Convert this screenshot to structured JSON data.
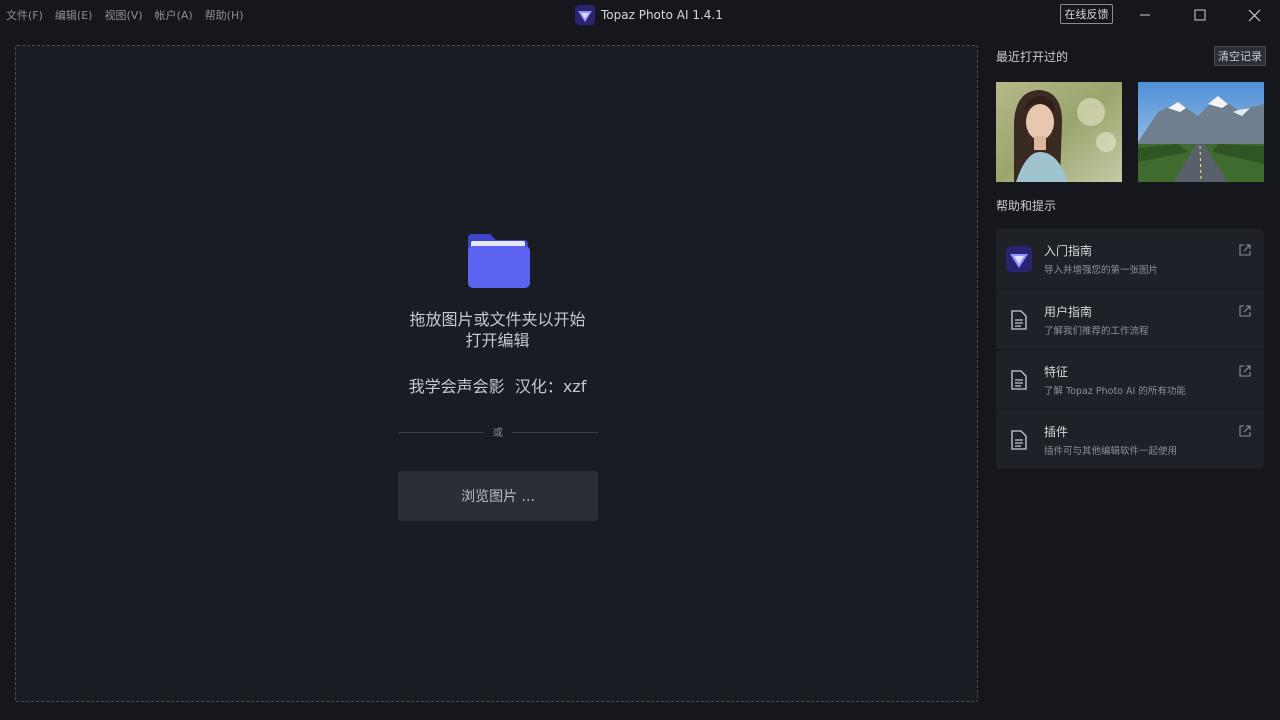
{
  "menu": [
    "文件(F)",
    "编辑(E)",
    "视图(V)",
    "帐户(A)",
    "帮助(H)"
  ],
  "app": {
    "title": "Topaz Photo AI 1.4.1",
    "logo_icon": "topaz-diamond-icon"
  },
  "feedback_label": "在线反馈",
  "window_controls": [
    "minimize-icon",
    "maximize-icon",
    "close-icon"
  ],
  "dropzone": {
    "folder_icon": "folder-icon",
    "line1": "拖放图片或文件夹以开始",
    "line2": "打开编辑",
    "credit": "我学会声会影  汉化：xzf",
    "or": "或",
    "browse": "浏览图片 ..."
  },
  "recent": {
    "title": "最近打开过的",
    "clear": "清空记录",
    "thumbs": [
      "portrait-photo",
      "mountain-road-photo"
    ]
  },
  "help": {
    "title": "帮助和提示",
    "items": [
      {
        "title": "入门指南",
        "desc": "导入并增强您的第一张图片",
        "icon": "topaz-diamond-icon"
      },
      {
        "title": "用户指南",
        "desc": "了解我们推荐的工作流程",
        "icon": "document-icon"
      },
      {
        "title": "特征",
        "desc": "了解 Topaz Photo AI 的所有功能",
        "icon": "document-icon"
      },
      {
        "title": "插件",
        "desc": "插件可与其他编辑软件一起使用",
        "icon": "document-icon"
      }
    ]
  },
  "colors": {
    "accent": "#5b63f0",
    "background": "#16171d",
    "panel": "#1f2128"
  }
}
